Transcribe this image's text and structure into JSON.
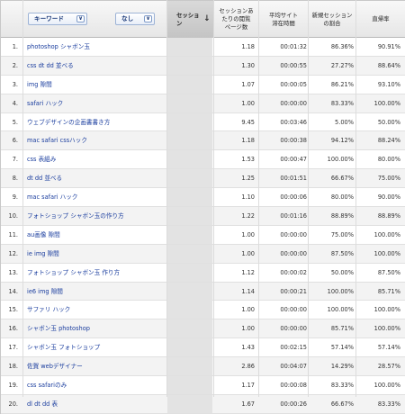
{
  "header": {
    "keyword_picker": "キーワード",
    "none_picker": "なし",
    "sessions_label": "セッション",
    "pages_per_session_line1": "セッションあ",
    "pages_per_session_line2": "たりの閲覧",
    "pages_per_session_line3": "ページ数",
    "avg_time_line1": "平均サイト",
    "avg_time_line2": "滞在時間",
    "new_sessions_line1": "新規セッション",
    "new_sessions_line2": "の割合",
    "bounce_label": "直帰率",
    "chevron_icon": "chevron-down-icon",
    "sort_icon": "sort-desc-icon"
  },
  "rows": [
    {
      "idx": "1.",
      "keyword": "photoshop シャボン玉",
      "pv": "1.18",
      "time": "00:01:32",
      "new": "86.36%",
      "bounce": "90.91%"
    },
    {
      "idx": "2.",
      "keyword": "css dt dd 並べる",
      "pv": "1.30",
      "time": "00:00:55",
      "new": "27.27%",
      "bounce": "88.64%"
    },
    {
      "idx": "3.",
      "keyword": "img 隙間",
      "pv": "1.07",
      "time": "00:00:05",
      "new": "86.21%",
      "bounce": "93.10%"
    },
    {
      "idx": "4.",
      "keyword": "safari ハック",
      "pv": "1.00",
      "time": "00:00:00",
      "new": "83.33%",
      "bounce": "100.00%"
    },
    {
      "idx": "5.",
      "keyword": "ウェブデザインの企画書書き方",
      "pv": "9.45",
      "time": "00:03:46",
      "new": "5.00%",
      "bounce": "50.00%"
    },
    {
      "idx": "6.",
      "keyword": "mac safari cssハック",
      "pv": "1.18",
      "time": "00:00:38",
      "new": "94.12%",
      "bounce": "88.24%"
    },
    {
      "idx": "7.",
      "keyword": "css 表組み",
      "pv": "1.53",
      "time": "00:00:47",
      "new": "100.00%",
      "bounce": "80.00%"
    },
    {
      "idx": "8.",
      "keyword": "dt dd 並べる",
      "pv": "1.25",
      "time": "00:01:51",
      "new": "66.67%",
      "bounce": "75.00%"
    },
    {
      "idx": "9.",
      "keyword": "mac safari ハック",
      "pv": "1.10",
      "time": "00:00:06",
      "new": "80.00%",
      "bounce": "90.00%"
    },
    {
      "idx": "10.",
      "keyword": "フォトショップ シャボン玉の作り方",
      "pv": "1.22",
      "time": "00:01:16",
      "new": "88.89%",
      "bounce": "88.89%"
    },
    {
      "idx": "11.",
      "keyword": "au画像 隙間",
      "pv": "1.00",
      "time": "00:00:00",
      "new": "75.00%",
      "bounce": "100.00%"
    },
    {
      "idx": "12.",
      "keyword": "ie img 隙間",
      "pv": "1.00",
      "time": "00:00:00",
      "new": "87.50%",
      "bounce": "100.00%"
    },
    {
      "idx": "13.",
      "keyword": "フォトショップ シャボン玉 作り方",
      "pv": "1.12",
      "time": "00:00:02",
      "new": "50.00%",
      "bounce": "87.50%"
    },
    {
      "idx": "14.",
      "keyword": "ie6 img 隙間",
      "pv": "1.14",
      "time": "00:00:21",
      "new": "100.00%",
      "bounce": "85.71%"
    },
    {
      "idx": "15.",
      "keyword": "サファリ ハック",
      "pv": "1.00",
      "time": "00:00:00",
      "new": "100.00%",
      "bounce": "100.00%"
    },
    {
      "idx": "16.",
      "keyword": "シャボン玉 photoshop",
      "pv": "1.00",
      "time": "00:00:00",
      "new": "85.71%",
      "bounce": "100.00%"
    },
    {
      "idx": "17.",
      "keyword": "シャボン玉 フォトショップ",
      "pv": "1.43",
      "time": "00:02:15",
      "new": "57.14%",
      "bounce": "57.14%"
    },
    {
      "idx": "18.",
      "keyword": "佐賀 webデザイナー",
      "pv": "2.86",
      "time": "00:04:07",
      "new": "14.29%",
      "bounce": "28.57%"
    },
    {
      "idx": "19.",
      "keyword": "css safariのみ",
      "pv": "1.17",
      "time": "00:00:08",
      "new": "83.33%",
      "bounce": "100.00%"
    },
    {
      "idx": "20.",
      "keyword": "dl dt dd 表",
      "pv": "1.67",
      "time": "00:00:26",
      "new": "66.67%",
      "bounce": "83.33%"
    }
  ]
}
